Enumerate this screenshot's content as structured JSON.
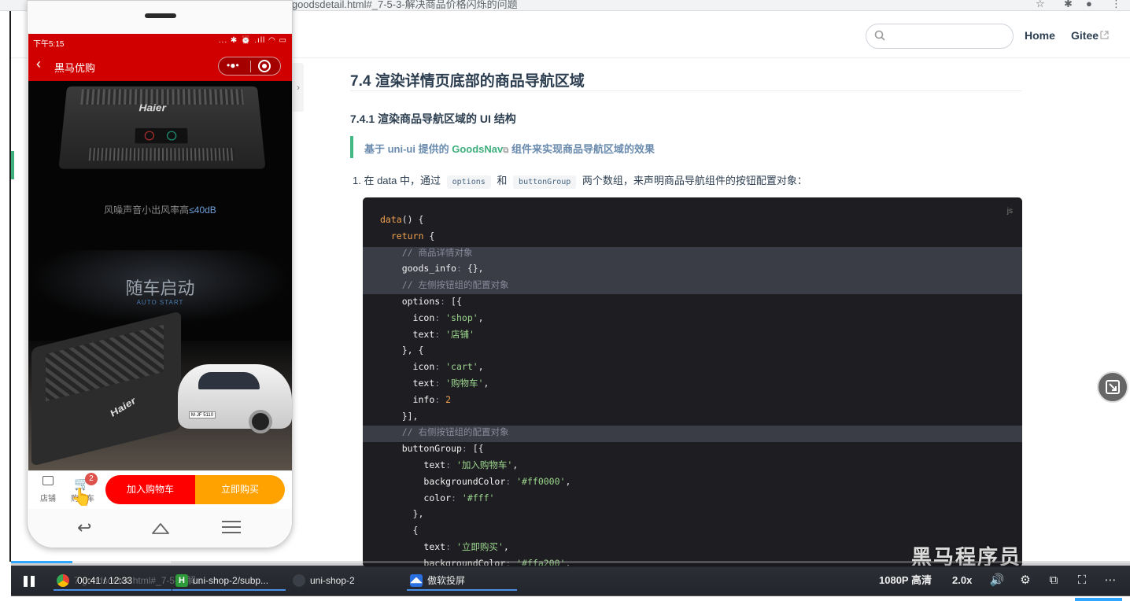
{
  "browser": {
    "url_fragment": "7.goodsdetail.html#_7-5-3-解决商品价格闪烁的问题"
  },
  "site": {
    "search_placeholder": "",
    "nav": [
      {
        "label": "Home"
      },
      {
        "label": "Gitee"
      }
    ]
  },
  "article": {
    "h2": "7.4 渲染详情页底部的商品导航区域",
    "h3": "7.4.1 渲染商品导航区域的 UI 结构",
    "tip_prefix": "基于 uni-ui 提供的 ",
    "tip_link": "GoodsNav",
    "tip_suffix": " 组件来实现商品导航区域的效果",
    "list_item": {
      "number": "1.",
      "part1": "在 data 中，通过",
      "code1": "options",
      "part2": "和",
      "code2": "buttonGroup",
      "part3": "两个数组，来声明商品导航组件的按钮配置对象："
    },
    "code_lang": "js"
  },
  "code_lines": [
    "data() {",
    "  return {",
    "    // 商品详情对象",
    "    goods_info: {},",
    "    // 左侧按钮组的配置对象",
    "    options: [{",
    "      icon: 'shop',",
    "      text: '店铺'",
    "    }, {",
    "      icon: 'cart',",
    "      text: '购物车',",
    "      info: 2",
    "    }],",
    "    // 右侧按钮组的配置对象",
    "    buttonGroup: [{",
    "        text: '加入购物车',",
    "        backgroundColor: '#ff0000',",
    "        color: '#fff'",
    "      },",
    "      {",
    "        text: '立即购买',",
    "        backgroundColor: '#ffa200',"
  ],
  "phone": {
    "time": "下午5:15",
    "status_icons": "... ✱ ⏰ .ıll ◠ ▭",
    "nav_title": "黑马优购",
    "product": {
      "brand": "Haier",
      "tagline_prefix": "风噪声音小出风率高",
      "tagline_value": "≤40dB",
      "headline": "随车启动",
      "subheadline": "AUTO START",
      "plate": "M·JF 5110"
    },
    "goods_nav": {
      "shop_label": "店铺",
      "cart_label": "购物车",
      "cart_badge": "2",
      "btn_cart": "加入购物车",
      "btn_buy": "立即购买",
      "btn_cart_color": "#ff0000",
      "btn_buy_color": "#ffa200"
    }
  },
  "watermark": "黑马程序员",
  "video": {
    "time": "00:41 / 12:33",
    "quality": "1080P 高清",
    "speed": "2.0x",
    "progress": 0.055,
    "buffered": 0.143
  },
  "taskbar": [
    {
      "label": "7.goodsdetail.html#_7-5-3-解...",
      "icon": "chrome-icon"
    },
    {
      "label": "uni-shop-2/subp...",
      "icon": "hbuilder-icon"
    },
    {
      "label": "uni-shop-2",
      "icon": "wechat-devtools-icon"
    },
    {
      "label": "傲软投屏",
      "icon": "apowermirror-icon"
    }
  ],
  "colors": {
    "theme_red": "#d10000",
    "accent_green": "#3eaf7c",
    "progress_blue": "#2fa6ff"
  }
}
